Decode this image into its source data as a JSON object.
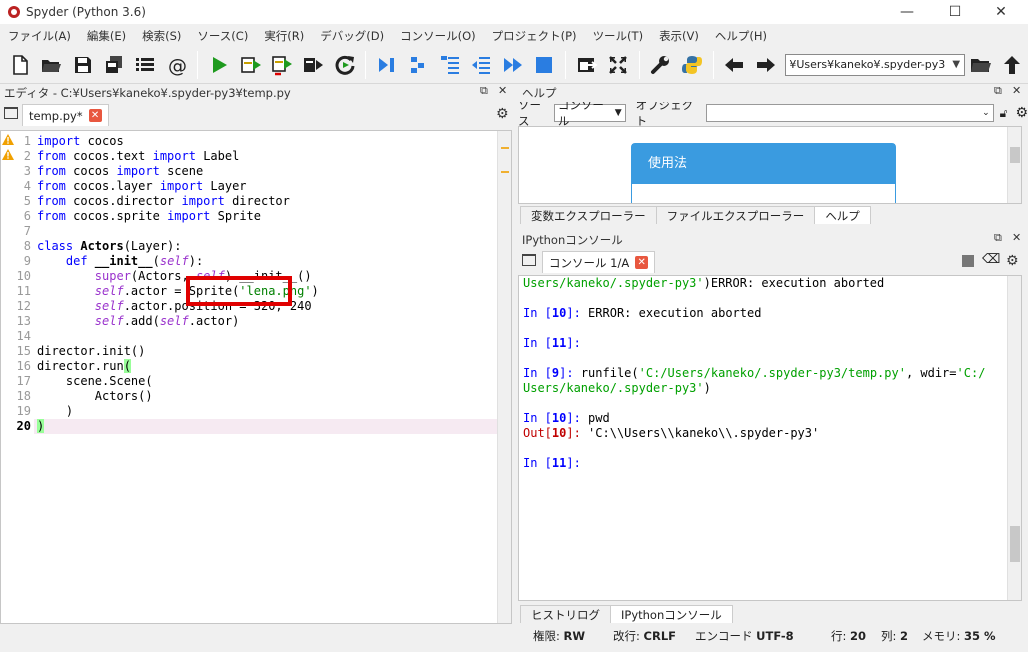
{
  "window": {
    "title": "Spyder (Python 3.6)",
    "minimize": "—",
    "maximize": "☐",
    "close": "✕"
  },
  "menu": [
    "ファイル(A)",
    "編集(E)",
    "検索(S)",
    "ソース(C)",
    "実行(R)",
    "デバッグ(D)",
    "コンソール(O)",
    "プロジェクト(P)",
    "ツール(T)",
    "表示(V)",
    "ヘルプ(H)"
  ],
  "toolbar": {
    "path": "¥Users¥kaneko¥.spyder-py3"
  },
  "editor": {
    "header": "エディタ - C:¥Users¥kaneko¥.spyder-py3¥temp.py",
    "tab": "temp.py*",
    "lines": [
      "1",
      "2",
      "3",
      "4",
      "5",
      "6",
      "7",
      "8",
      "9",
      "10",
      "11",
      "12",
      "13",
      "14",
      "15",
      "16",
      "17",
      "18",
      "19",
      "20"
    ],
    "code": {
      "l1a": "import",
      "l1b": " cocos",
      "l2a": "from",
      "l2b": " cocos.text ",
      "l2c": "import",
      "l2d": " Label",
      "l3a": "from",
      "l3b": " cocos ",
      "l3c": "import",
      "l3d": " scene",
      "l4a": "from",
      "l4b": " cocos.layer ",
      "l4c": "import",
      "l4d": " Layer",
      "l5a": "from",
      "l5b": " cocos.director ",
      "l5c": "import",
      "l5d": " director",
      "l6a": "from",
      "l6b": " cocos.sprite ",
      "l6c": "import",
      "l6d": " Sprite",
      "l8a": "class",
      "l8b": " Actors",
      "l8c": "(Layer):",
      "l9a": "    def",
      "l9b": " __init__",
      "l9c": "(",
      "l9d": "self",
      "l9e": "):",
      "l10a": "        ",
      "l10b": "super",
      "l10c": "(Actors, ",
      "l10d": "self",
      "l10e": ").__init__()",
      "l11a": "        ",
      "l11b": "self",
      "l11c": ".actor = Sprite(",
      "l11d": "'lena.png'",
      "l11e": ")",
      "l12a": "        ",
      "l12b": "self",
      "l12c": ".actor.position = 320, 240",
      "l13a": "        ",
      "l13b": "self",
      "l13c": ".add(",
      "l13d": "self",
      "l13e": ".actor)",
      "l15": "director.init()",
      "l16a": "director.run",
      "l16b": "(",
      "l17": "    scene.Scene(",
      "l18": "        Actors()",
      "l19": "    )",
      "l20": ")"
    }
  },
  "help": {
    "header": "ヘルプ",
    "source_label": "ソース",
    "source_value": "コンソール",
    "object_label": "オブジェクト",
    "usage_title": "使用法",
    "tabs": [
      "変数エクスプローラー",
      "ファイルエクスプローラー",
      "ヘルプ"
    ]
  },
  "console": {
    "header": "IPythonコンソール",
    "tab": "コンソール 1/A",
    "lines": {
      "c1a": "Users/kaneko/.spyder-py3'",
      "c1b": ")ERROR: execution aborted",
      "c2a": "In [",
      "c2b": "10",
      "c2c": "]: ",
      "c2d": "ERROR: execution aborted",
      "c3a": "In [",
      "c3b": "11",
      "c3c": "]:",
      "c4a": "In [",
      "c4b": "9",
      "c4c": "]: ",
      "c4d": "runfile(",
      "c4e": "'C:/Users/kaneko/.spyder-py3/temp.py'",
      "c4f": ", wdir=",
      "c4g": "'C:/",
      "c5a": "Users/kaneko/.spyder-py3'",
      "c5b": ")",
      "c6a": "In [",
      "c6b": "10",
      "c6c": "]: ",
      "c6d": "pwd",
      "c7a": "Out[",
      "c7b": "10",
      "c7c": "]: ",
      "c7d": "'C:\\\\Users\\\\kaneko\\\\.spyder-py3'",
      "c8a": "In [",
      "c8b": "11",
      "c8c": "]:"
    },
    "tabs": [
      "ヒストリログ",
      "IPythonコンソール"
    ]
  },
  "status": {
    "perm_label": "権限:",
    "perm": "RW",
    "eol_label": "改行:",
    "eol": "CRLF",
    "enc_label": "エンコード",
    "enc": "UTF-8",
    "line_label": "行:",
    "line": "20",
    "col_label": "列:",
    "col": "2",
    "mem_label": "メモリ:",
    "mem": "35 %"
  }
}
